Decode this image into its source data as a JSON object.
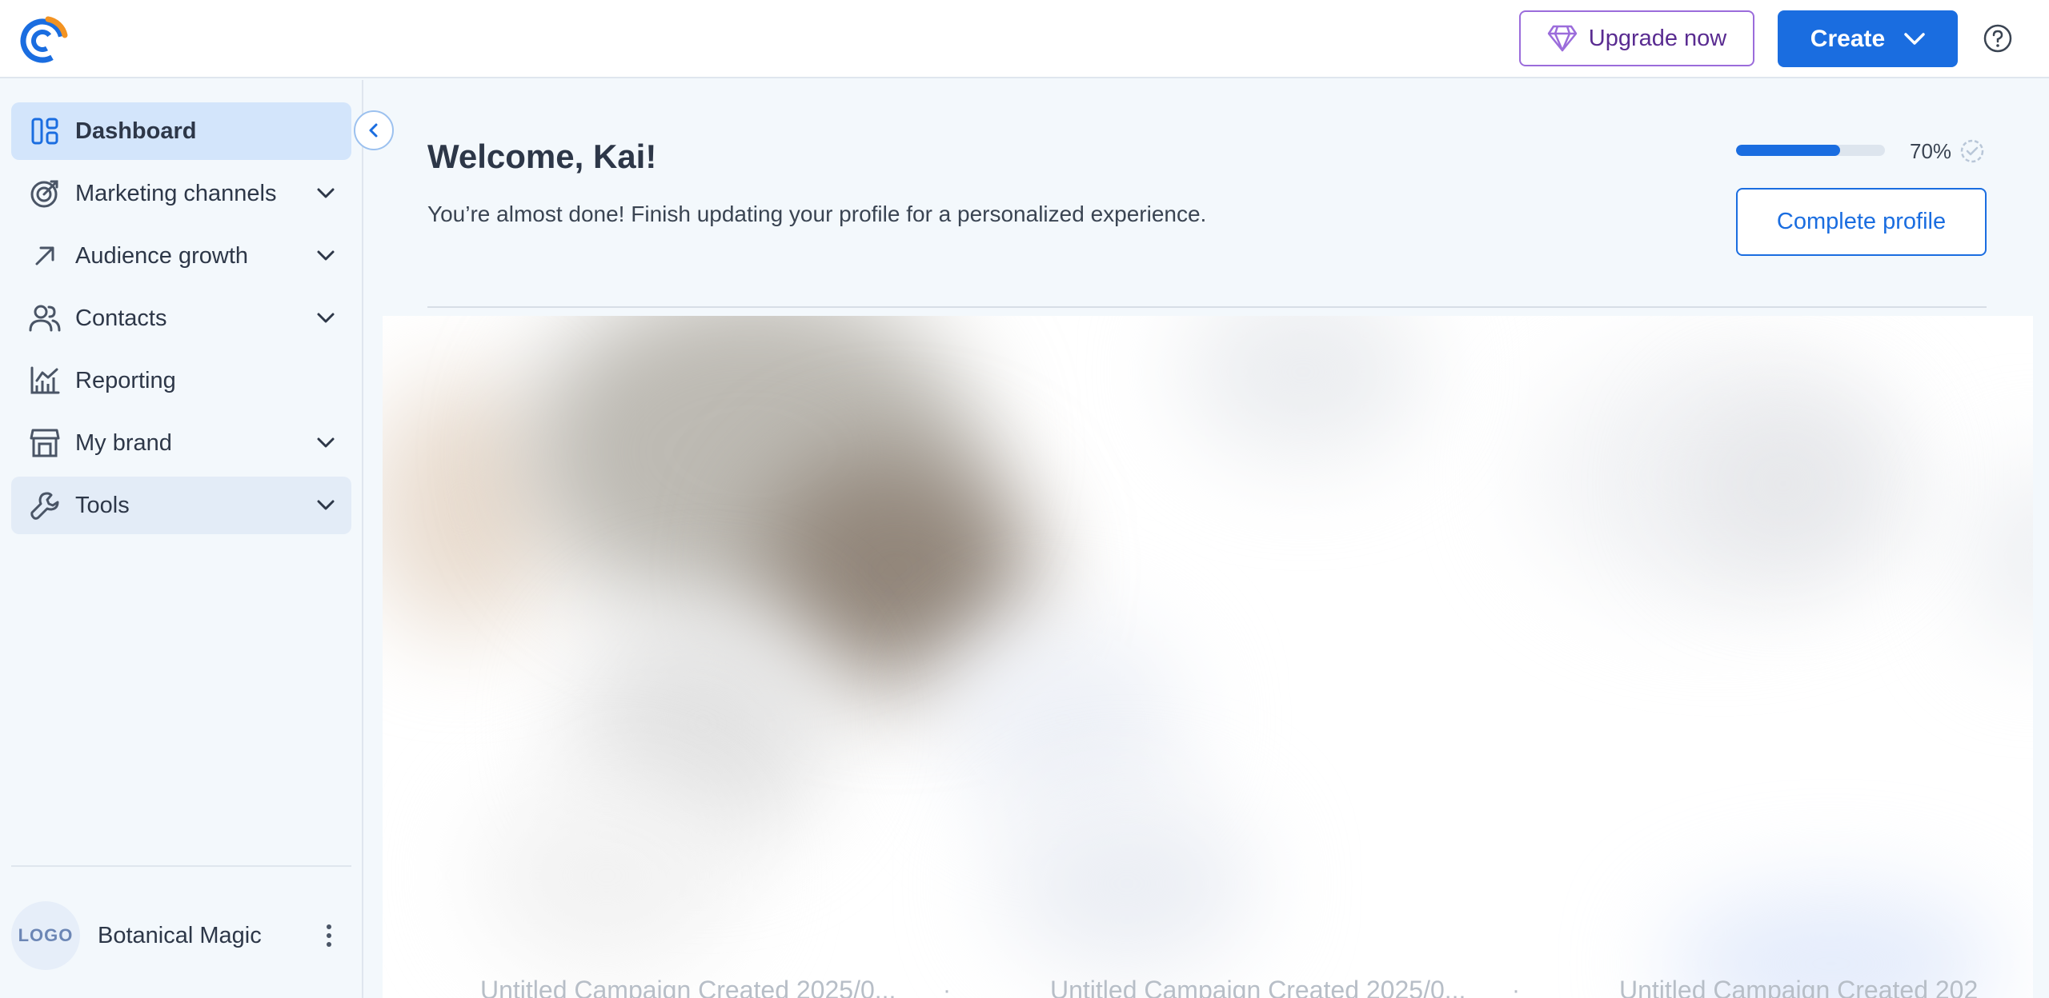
{
  "header": {
    "upgrade_label": "Upgrade now",
    "create_label": "Create",
    "icons": [
      "brand-logo-icon",
      "diamond-icon",
      "chevron-down-icon",
      "help-icon"
    ]
  },
  "sidebar": {
    "items": [
      {
        "label": "Dashboard",
        "icon": "dashboard-icon",
        "active": true,
        "expandable": false
      },
      {
        "label": "Marketing channels",
        "icon": "target-icon",
        "expandable": true
      },
      {
        "label": "Audience growth",
        "icon": "arrow-up-right-icon",
        "expandable": true
      },
      {
        "label": "Contacts",
        "icon": "people-icon",
        "expandable": true
      },
      {
        "label": "Reporting",
        "icon": "chart-icon",
        "expandable": false
      },
      {
        "label": "My brand",
        "icon": "store-icon",
        "expandable": true
      },
      {
        "label": "Tools",
        "icon": "wrench-icon",
        "expandable": true,
        "highlighted": true
      }
    ],
    "account": {
      "avatar_text": "LOGO",
      "name": "Botanical Magic"
    }
  },
  "main": {
    "welcome_title": "Welcome, Kai!",
    "welcome_subtitle": "You’re almost done! Finish updating your profile for a personalized experience.",
    "progress": {
      "percent_label": "70%",
      "fraction": 0.7
    },
    "complete_profile_label": "Complete profile",
    "cards": [
      {
        "title": "Untitled Campaign Created 2025/0..."
      },
      {
        "title": "Untitled Campaign Created 2025/0..."
      },
      {
        "title": "Untitled Campaign Created 202"
      }
    ]
  },
  "colors": {
    "primary": "#1a6de0",
    "upgrade_border": "#9b6cdb",
    "upgrade_text": "#5a2c91",
    "active_nav": "#d3e5fb",
    "sidebar_bg": "#f3f8fc"
  }
}
